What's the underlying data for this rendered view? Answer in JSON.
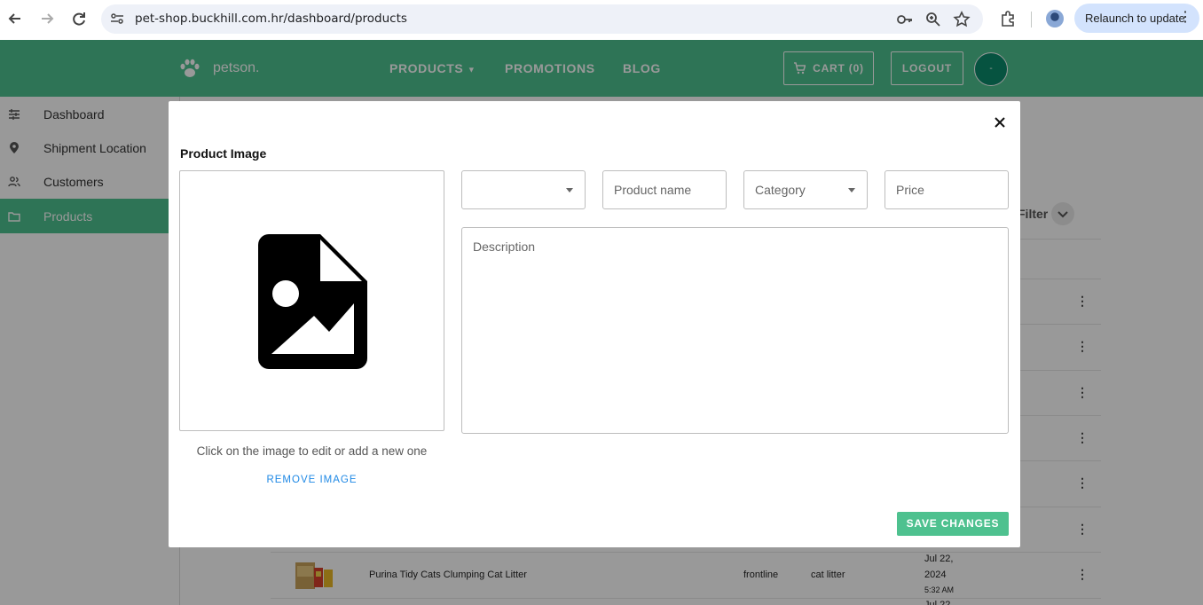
{
  "browser": {
    "url": "pet-shop.buckhill.com.hr/dashboard/products",
    "relaunch_label": "Relaunch to update",
    "icons": [
      "back-icon",
      "forward-icon",
      "reload-icon",
      "site-settings-icon",
      "password-key-icon",
      "zoom-icon",
      "bookmark-star-icon",
      "extensions-icon",
      "profile-avatar",
      "more-menu-icon"
    ]
  },
  "header": {
    "brand": "petson.",
    "nav": {
      "products": "PRODUCTS",
      "promotions": "PROMOTIONS",
      "blog": "BLOG"
    },
    "cart_label": "CART (0)",
    "logout_label": "LOGOUT",
    "avatar_text": "-",
    "color": "#4ec18f"
  },
  "sidebar": {
    "items": [
      {
        "label": "Dashboard",
        "icon": "sliders-icon"
      },
      {
        "label": "Shipment Location",
        "icon": "location-pin-icon"
      },
      {
        "label": "Customers",
        "icon": "people-icon"
      },
      {
        "label": "Products",
        "icon": "folder-icon",
        "active": true
      }
    ]
  },
  "background_table": {
    "filter_label": "Filter",
    "visible_row": {
      "name": "Purina Tidy Cats Clumping Cat Litter",
      "brand": "frontline",
      "category": "cat litter",
      "date": "Jul 22, 2024",
      "time": "5:32 AM"
    },
    "partial_date": "Jul 22"
  },
  "modal": {
    "title": "Product Image",
    "image_hint": "Click on the image to edit or add a new one",
    "remove_image_label": "REMOVE IMAGE",
    "fields": {
      "select_value": "",
      "product_name_placeholder": "Product name",
      "category_placeholder": "Category",
      "price_placeholder": "Price",
      "description_placeholder": "Description"
    },
    "save_label": "SAVE CHANGES",
    "accent_color": "#4ec18f",
    "link_color": "#1e88e5"
  }
}
